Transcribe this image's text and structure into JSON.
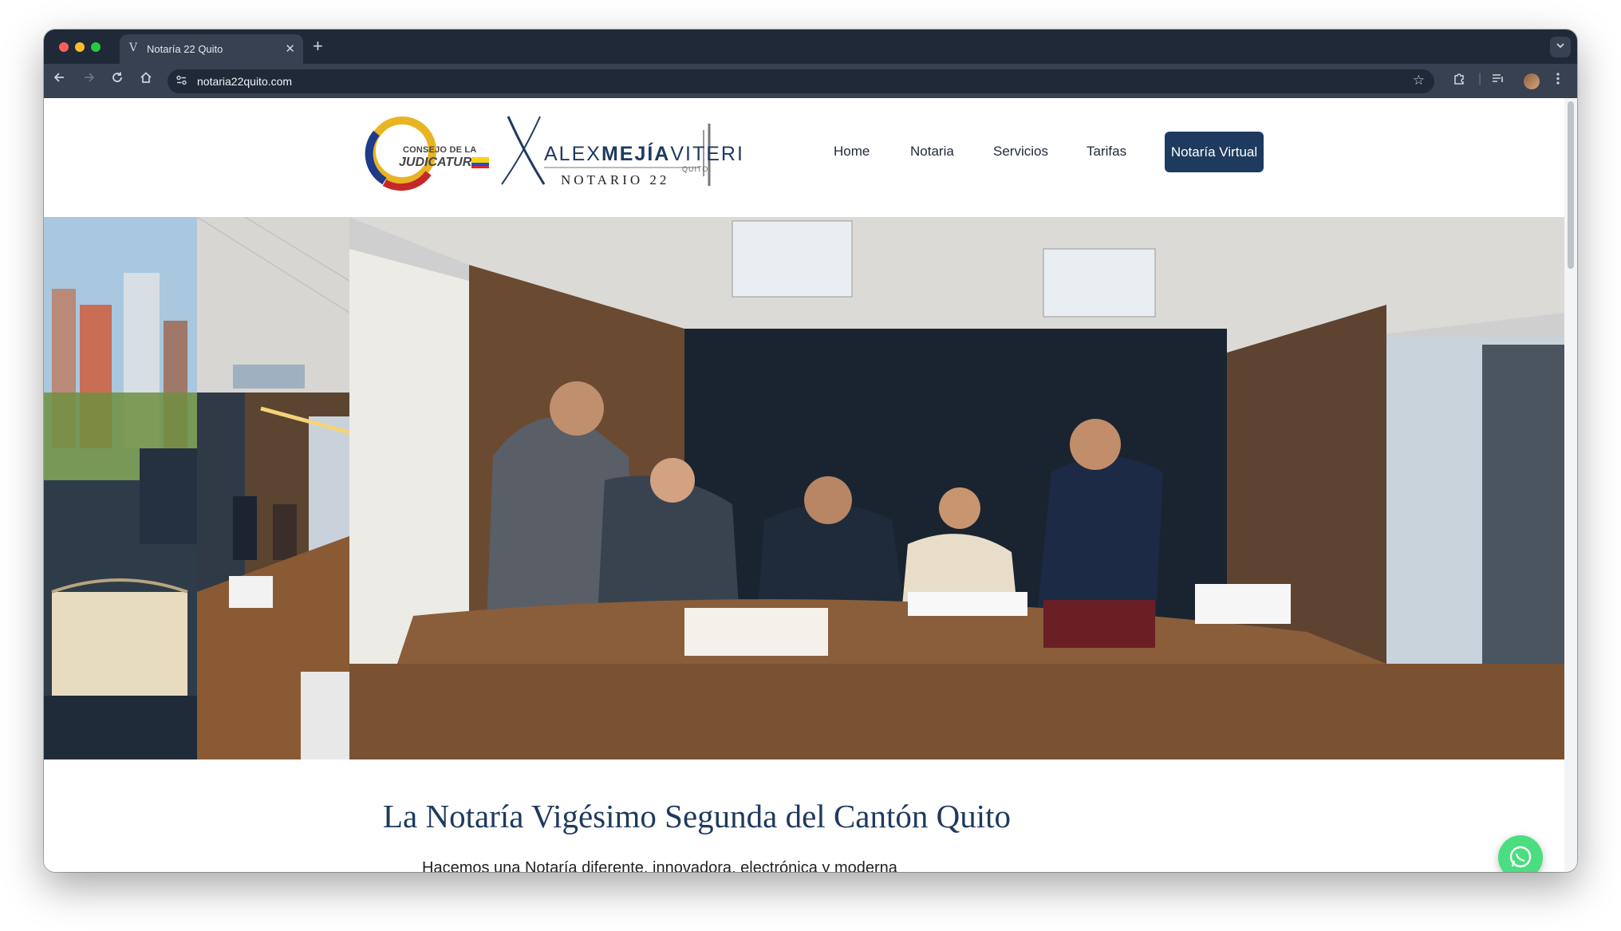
{
  "browser": {
    "tab_title": "Notaría 22 Quito",
    "tab_favicon": "V",
    "tab_close": "✕",
    "new_tab": "+",
    "url": "notaria22quito.com",
    "icons": [
      "back-icon",
      "forward-icon",
      "reload-icon",
      "home-icon",
      "site-settings-icon",
      "star-icon",
      "extensions-icon",
      "reading-list-icon",
      "profile-avatar",
      "menu-icon"
    ]
  },
  "header": {
    "cj_logo": {
      "line1": "CONSEJO DE LA",
      "line2": "JUDICATURA"
    },
    "notary_logo": {
      "first": "ALEX",
      "middle": "MEJÍA",
      "last": "VITERI",
      "city": "QUITO",
      "subtitle": "NOTARIO 22"
    },
    "nav": [
      {
        "label": "Home"
      },
      {
        "label": "Notaria"
      },
      {
        "label": "Servicios"
      },
      {
        "label": "Tarifas"
      }
    ],
    "cta_label": "Notaría Virtual"
  },
  "hero": {
    "panels": [
      "city-view-photo",
      "office-meeting-photo",
      "team-meeting-photo"
    ]
  },
  "main": {
    "headline": "La Notaría Vigésimo Segunda del Cantón Quito",
    "subline": "Hacemos una Notaría diferente, innovadora, electrónica y moderna"
  },
  "colors": {
    "brand_navy": "#1e3a5f",
    "whatsapp_green": "#4ade80",
    "chrome_dark": "#1f2937"
  }
}
